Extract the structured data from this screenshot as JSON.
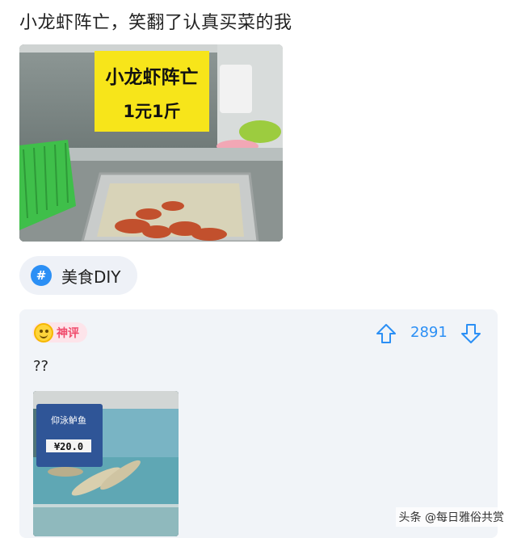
{
  "post": {
    "title": "小龙虾阵亡，笑翻了认真买菜的我",
    "image": {
      "sign_line1": "小龙虾阵亡",
      "sign_line2": "1元1斤"
    }
  },
  "topic": {
    "icon": "hash-icon",
    "symbol": "#",
    "label": "美食DIY"
  },
  "comment": {
    "badge": "神评",
    "badge_icon": "laughing-face-icon",
    "vote_count": "2891",
    "text": "??",
    "image": {
      "sign_line1": "仰泳鲈鱼",
      "price": "¥20.0"
    }
  },
  "watermark": "头条 @每日雅俗共赏",
  "colors": {
    "accent": "#2b8ff5",
    "badge_text": "#f04a6b",
    "card_bg": "#f1f4f8",
    "sign_yellow": "#f7e51a"
  }
}
